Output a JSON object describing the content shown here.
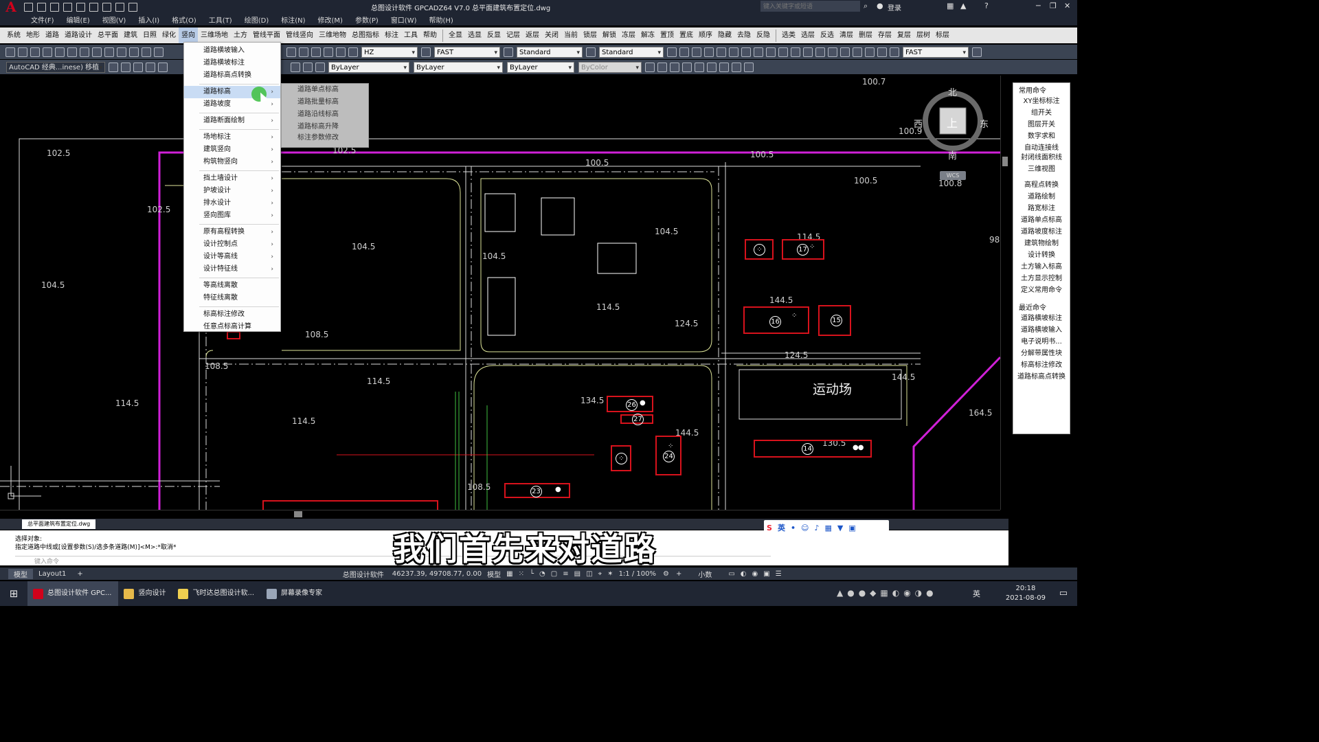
{
  "app": {
    "logo": "A",
    "title": "总图设计软件 GPCADZ64 V7.0    总平面建筑布置定位.dwg",
    "search_placeholder": "键入关键字或短语",
    "login": "登录",
    "help": "?"
  },
  "menubar": [
    "文件(F)",
    "编辑(E)",
    "视图(V)",
    "插入(I)",
    "格式(O)",
    "工具(T)",
    "绘图(D)",
    "标注(N)",
    "修改(M)",
    "参数(P)",
    "窗口(W)",
    "帮助(H)"
  ],
  "ribbon_left": [
    "系统",
    "地形",
    "道路",
    "道路设计",
    "总平面",
    "建筑",
    "日照",
    "绿化",
    "竖向",
    "三维场地",
    "土方",
    "管线平面",
    "管线竖向",
    "三维地物",
    "总图指标",
    "标注",
    "工具",
    "帮助"
  ],
  "ribbon_active": "竖向",
  "ribbon_right": [
    "全显",
    "选显",
    "反显",
    "记层",
    "返层",
    "关闭",
    "当前",
    "锁层",
    "解锁",
    "冻层",
    "解冻",
    "置顶",
    "置底",
    "顺序",
    "隐藏",
    "去隐",
    "反隐",
    "选类",
    "选层",
    "反选",
    "清层",
    "删层",
    "存层",
    "复层",
    "层树",
    "标层"
  ],
  "toolbar1": {
    "textstyle": "HZ",
    "font": "FAST",
    "dimstyle": "Standard",
    "tablestyle": "Standard",
    "font2": "FAST"
  },
  "toolbar2": {
    "workspace": "AutoCAD 经典...inese) 移植",
    "color": "ByLayer",
    "linetype": "ByLayer",
    "lineweight": "ByLayer",
    "plotstyle": "ByColor"
  },
  "dropdown": {
    "items_top": [
      "道路横坡输入",
      "道路横坡标注",
      "道路标高点转换"
    ],
    "items_a": [
      "道路标高",
      "道路坡度"
    ],
    "items_b": [
      "道路断面绘制"
    ],
    "items_c": [
      "场地标注",
      "建筑竖向",
      "构筑物竖向"
    ],
    "items_d": [
      "挡土墙设计",
      "护坡设计",
      "排水设计",
      "竖向图库"
    ],
    "items_e": [
      "原有高程转换",
      "设计控制点",
      "设计等高线",
      "设计特征线"
    ],
    "items_f": [
      "等高线离散",
      "特征线离散"
    ],
    "items_g": [
      "标高标注修改",
      "任意点标高计算"
    ]
  },
  "submenu": [
    "道路单点标高",
    "道路批量标高",
    "道路沿线标高",
    "道路标高升降",
    "标注参数修改"
  ],
  "compass": {
    "n": "北",
    "s": "南",
    "e": "东",
    "w": "西",
    "center": "上",
    "wcs": "WCS"
  },
  "elevations": [
    "100.7",
    "102.5",
    "102.5",
    "104.5",
    "104.5",
    "104.5",
    "104.5",
    "100.5",
    "100.5",
    "100.9",
    "100.5",
    "114.5",
    "114.5",
    "114.5",
    "114.5",
    "114.5",
    "124.5",
    "124.5",
    "134.5",
    "144.5",
    "144.5",
    "144.5",
    "130.5",
    "164.5",
    "108.5",
    "108.5",
    "108.5",
    "98",
    "100.8",
    "102.5"
  ],
  "buildings": [
    "17",
    "16",
    "15",
    "26",
    "27",
    "24",
    "14",
    "23"
  ],
  "sports": "运动场",
  "rightpanel": {
    "head1": "常用命令",
    "items1": [
      "XY坐标标注",
      "组开关",
      "图层开关",
      "数字求和",
      "自动连接线",
      "封闭线面积线",
      "三维视图",
      "高程点转换",
      "道路绘制",
      "路宽标注",
      "道路单点标高",
      "道路坡度标注",
      "建筑物绘制",
      "设计转换",
      "土方输入标高",
      "土方显示控制",
      "定义常用命令"
    ],
    "head2": "最近命令",
    "items2": [
      "道路横坡标注",
      "道路横坡输入",
      "电子说明书...",
      "分解带属性块",
      "标高标注修改",
      "道路标高点转换"
    ]
  },
  "tabbar": {
    "doc": "总平面建筑布置定位.dwg"
  },
  "cmd": {
    "line1": "选择对象:",
    "line2": "指定道路中线或[设置参数(S)/选多条道路(M)]<M>:*取消*",
    "placeholder": "键入命令"
  },
  "subtitle": "我们首先来对道路",
  "status": {
    "tab_model": "模型",
    "tab_layout": "Layout1",
    "add": "+",
    "app": "总图设计软件",
    "coords": "46237.39, 49708.77, 0.00",
    "mode": "模型",
    "scale": "1:1 / 100%",
    "units": "小数"
  },
  "taskbar": {
    "items": [
      "总图设计软件 GPC...",
      "竖向设计",
      "飞时达总图设计软...",
      "屏幕录像专家"
    ],
    "time": "20:18",
    "date": "2021-08-09",
    "lang": "英"
  },
  "ime": {
    "label": "英"
  }
}
